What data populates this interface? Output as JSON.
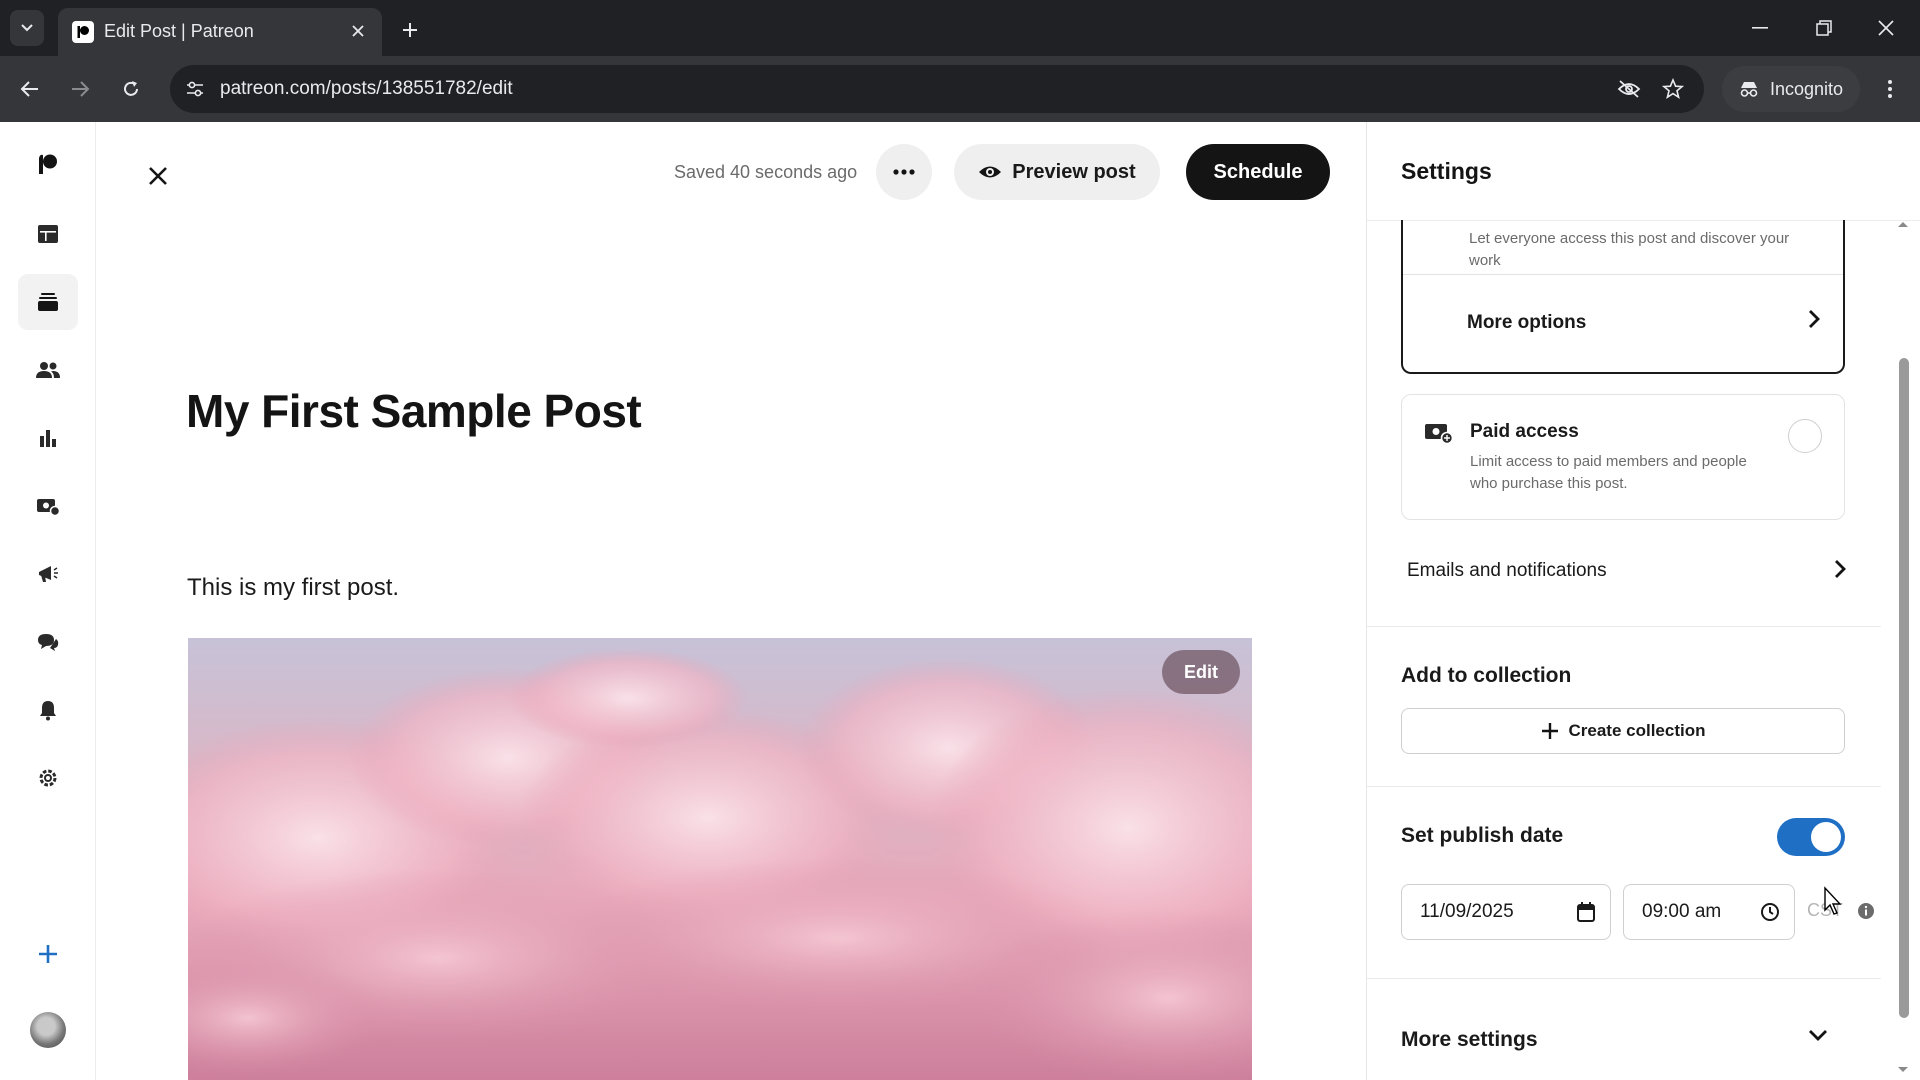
{
  "browser": {
    "tab_title": "Edit Post | Patreon",
    "url": "patreon.com/posts/138551782/edit",
    "incognito_label": "Incognito"
  },
  "toolbar": {
    "saved_status": "Saved 40 seconds ago",
    "preview_label": "Preview post",
    "schedule_label": "Schedule"
  },
  "nav": {
    "icons": [
      "patreon-logo-icon",
      "dashboard-icon",
      "library-icon",
      "audience-icon",
      "insights-icon",
      "payouts-icon",
      "promotions-icon",
      "chats-icon",
      "notifications-icon",
      "settings-icon",
      "create-icon"
    ],
    "active_item": "library-icon"
  },
  "post": {
    "title": "My First Sample Post",
    "body": "This is my first post.",
    "image_edit_label": "Edit"
  },
  "settings": {
    "title": "Settings",
    "public_desc": "Let everyone access this post and discover your work",
    "more_options_label": "More options",
    "paid_access_label": "Paid access",
    "paid_access_desc": "Limit access to paid members and people who purchase this post.",
    "emails_label": "Emails and notifications",
    "add_to_collection_title": "Add to collection",
    "create_collection_label": "Create collection",
    "set_publish_date_label": "Set publish date",
    "publish_date_enabled": true,
    "date_value": "11/09/2025",
    "time_value": "09:00 am",
    "timezone": "CST",
    "more_settings_label": "More settings"
  },
  "colors": {
    "primary_button": "#141414",
    "toggle_on": "#1f6fc5",
    "browser_dark": "#202124"
  }
}
